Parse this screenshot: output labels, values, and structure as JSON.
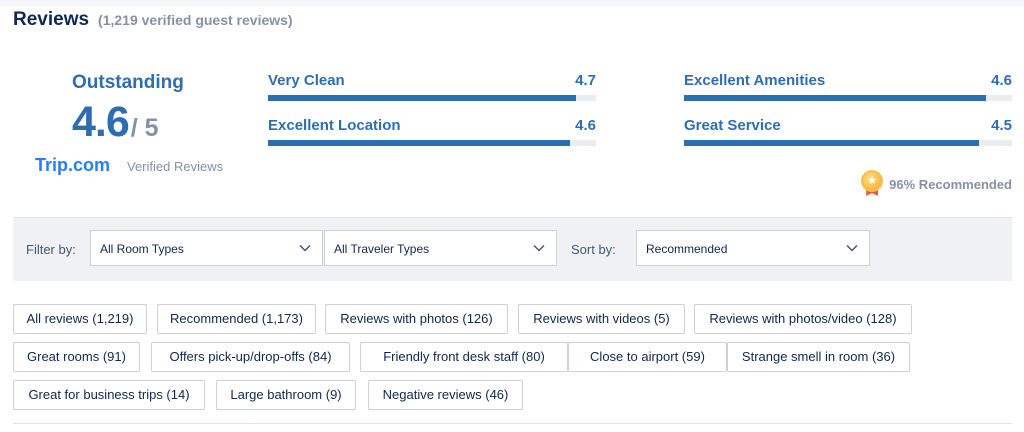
{
  "header": {
    "title": "Reviews",
    "count": "(1,219 verified guest reviews)"
  },
  "score": {
    "label": "Outstanding",
    "value": "4.6",
    "max": "/ 5",
    "brand": "Trip.com",
    "verified": "Verified Reviews"
  },
  "ratings": [
    {
      "label": "Very Clean",
      "value": "4.7",
      "fill": 0.94
    },
    {
      "label": "Excellent Location",
      "value": "4.6",
      "fill": 0.92
    },
    {
      "label": "Excellent Amenities",
      "value": "4.6",
      "fill": 0.92
    },
    {
      "label": "Great Service",
      "value": "4.5",
      "fill": 0.9
    }
  ],
  "recommend": {
    "text": "96% Recommended"
  },
  "filters": {
    "filter_label": "Filter by:",
    "room_types": "All Room Types",
    "traveler_types": "All Traveler Types",
    "sort_label": "Sort by:",
    "sort_value": "Recommended"
  },
  "tags": [
    "All reviews (1,219)",
    "Recommended (1,173)",
    "Reviews with photos (126)",
    "Reviews with videos (5)",
    "Reviews with photos/video (128)",
    "Great rooms (91)",
    "Offers pick-up/drop-offs (84)",
    "Friendly front desk staff (80)",
    "Close to airport (59)",
    "Strange smell in room (36)",
    "Great for business trips (14)",
    "Large bathroom (9)",
    "Negative reviews (46)"
  ],
  "colors": {
    "accent": "#2f6db3",
    "brand": "#287dfa",
    "muted": "#8592a6",
    "text": "#0f294d",
    "bar_track": "#eaecef",
    "filter_bg": "#eff1f4"
  },
  "icons": {
    "recommend": "medal-icon",
    "dropdown": "chevron-down-icon"
  }
}
